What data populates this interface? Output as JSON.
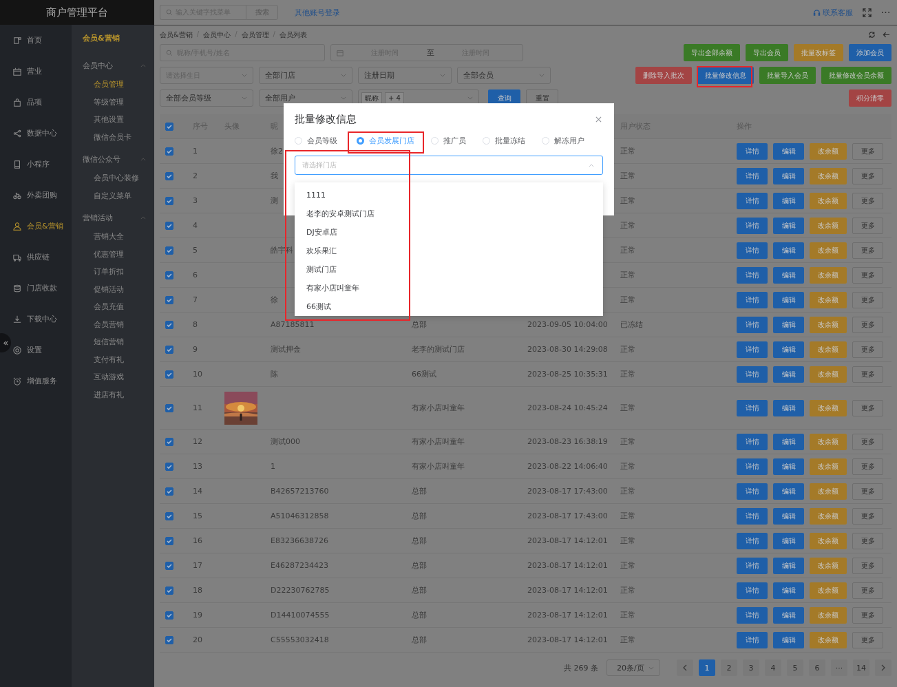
{
  "app": {
    "title": "商户管理平台"
  },
  "sidebar": {
    "items": [
      {
        "label": "首页",
        "selected": false
      },
      {
        "label": "营业",
        "selected": false
      },
      {
        "label": "品项",
        "selected": false
      },
      {
        "label": "数据中心",
        "selected": false
      },
      {
        "label": "小程序",
        "selected": false
      },
      {
        "label": "外卖团购",
        "selected": false
      },
      {
        "label": "会员&营销",
        "selected": true
      },
      {
        "label": "供应链",
        "selected": false
      },
      {
        "label": "门店收款",
        "selected": false
      },
      {
        "label": "下载中心",
        "selected": false
      },
      {
        "label": "设置",
        "selected": false
      },
      {
        "label": "增值服务",
        "selected": false
      }
    ]
  },
  "submenu": {
    "title": "会员&营销",
    "groups": [
      {
        "label": "会员中心",
        "expanded": true,
        "items": [
          {
            "label": "会员管理",
            "selected": true
          },
          {
            "label": "等级管理",
            "selected": false
          },
          {
            "label": "其他设置",
            "selected": false
          },
          {
            "label": "微信会员卡",
            "selected": false
          }
        ]
      },
      {
        "label": "微信公众号",
        "expanded": true,
        "items": [
          {
            "label": "会员中心装修",
            "selected": false
          },
          {
            "label": "自定义菜单",
            "selected": false
          }
        ]
      },
      {
        "label": "营销活动",
        "expanded": true,
        "items": [
          {
            "label": "营销大全",
            "selected": false
          },
          {
            "label": "优惠管理",
            "selected": false
          },
          {
            "label": "订单折扣",
            "selected": false
          },
          {
            "label": "促销活动",
            "selected": false
          },
          {
            "label": "会员充值",
            "selected": false
          },
          {
            "label": "会员营销",
            "selected": false
          },
          {
            "label": "短信营销",
            "selected": false
          },
          {
            "label": "支付有礼",
            "selected": false
          },
          {
            "label": "互动游戏",
            "selected": false
          },
          {
            "label": "进店有礼",
            "selected": false
          }
        ]
      }
    ]
  },
  "topbar": {
    "search_placeholder": "输入关键字找菜单",
    "search_button": "搜索",
    "other_login": "其他账号登录",
    "support": "联系客服"
  },
  "breadcrumb": {
    "items": [
      "会员&营销",
      "会员中心",
      "会员管理",
      "会员列表"
    ],
    "separator": "/"
  },
  "filters": {
    "search": {
      "placeholder": "昵称/手机号/姓名"
    },
    "date_range": {
      "start_placeholder": "注册时间",
      "separator": "至",
      "end_placeholder": "注册时间"
    },
    "row2": [
      {
        "placeholder": "请选择生日"
      },
      {
        "value": "全部门店"
      },
      {
        "value": "注册日期"
      },
      {
        "value": "全部会员"
      }
    ],
    "row3": [
      {
        "value": "全部会员等级"
      },
      {
        "value": "全部用户"
      }
    ],
    "tag_select": {
      "tags": [
        "昵称",
        "+ 4"
      ]
    },
    "query_button": "查询",
    "reset_button": "重置"
  },
  "actions": [
    [
      {
        "label": "导出全部余额",
        "kind": "success"
      },
      {
        "label": "导出会员",
        "kind": "success"
      },
      {
        "label": "批量改标签",
        "kind": "warning"
      },
      {
        "label": "添加会员",
        "kind": "primary"
      }
    ],
    [
      {
        "label": "删除导入批次",
        "kind": "danger"
      },
      {
        "label": "批量修改信息",
        "kind": "primary"
      },
      {
        "label": "批量导入会员",
        "kind": "success"
      },
      {
        "label": "批量修改会员余额",
        "kind": "success"
      }
    ],
    [
      {
        "label": "积分清零",
        "kind": "danger"
      }
    ]
  ],
  "table": {
    "header": {
      "checked": true,
      "no": "序号",
      "avatar": "头像",
      "nickname": "昵",
      "status": "用户状态",
      "actions": "操作"
    },
    "rows": [
      {
        "checked": true,
        "no": "1",
        "nickname": "徐2",
        "status": "正常",
        "actions": [
          "详情",
          "编辑",
          "改余额",
          "更多"
        ]
      },
      {
        "checked": true,
        "no": "2",
        "nickname": "我",
        "status": "正常",
        "actions": [
          "详情",
          "编辑",
          "改余额",
          "更多"
        ]
      },
      {
        "checked": true,
        "no": "3",
        "nickname": "测",
        "status": "正常",
        "actions": [
          "详情",
          "编辑",
          "改余额",
          "更多"
        ]
      },
      {
        "checked": true,
        "no": "4",
        "status": "正常",
        "actions": [
          "详情",
          "编辑",
          "改余额",
          "更多"
        ]
      },
      {
        "checked": true,
        "no": "5",
        "nickname": "皓宇科",
        "status": "正常",
        "actions": [
          "详情",
          "编辑",
          "改余额",
          "更多"
        ]
      },
      {
        "checked": true,
        "no": "6",
        "status": "正常",
        "actions": [
          "详情",
          "编辑",
          "改余额",
          "更多"
        ]
      },
      {
        "checked": true,
        "no": "7",
        "nickname": "徐",
        "status": "正常",
        "actions": [
          "详情",
          "编辑",
          "改余额",
          "更多"
        ]
      },
      {
        "checked": true,
        "no": "8",
        "nickname": "A87185811",
        "store": "总部",
        "date": "2023-09-05 10:04:00",
        "status": "已冻结",
        "actions": [
          "详情",
          "编辑",
          "改余额",
          "更多"
        ]
      },
      {
        "checked": true,
        "no": "9",
        "nickname": "测试押金",
        "store": "老李的测试门店",
        "date": "2023-08-30 14:29:08",
        "status": "正常",
        "actions": [
          "详情",
          "编辑",
          "改余额",
          "更多"
        ]
      },
      {
        "checked": true,
        "no": "10",
        "nickname": "陈",
        "store": "66测试",
        "date": "2023-08-25 10:35:31",
        "status": "正常",
        "actions": [
          "详情",
          "编辑",
          "改余额",
          "更多"
        ]
      },
      {
        "checked": true,
        "no": "11",
        "avatar": {
          "kind": "picture"
        },
        "store": "有家小店叫童年",
        "date": "2023-08-24 10:45:24",
        "status": "正常",
        "actions": [
          "详情",
          "编辑",
          "改余额",
          "更多"
        ]
      },
      {
        "checked": true,
        "no": "12",
        "nickname": "测试000",
        "store": "有家小店叫童年",
        "date": "2023-08-23 16:38:19",
        "status": "正常",
        "actions": [
          "详情",
          "编辑",
          "改余额",
          "更多"
        ]
      },
      {
        "checked": true,
        "no": "13",
        "nickname": "1",
        "store": "有家小店叫童年",
        "date": "2023-08-22 14:06:40",
        "status": "正常",
        "actions": [
          "详情",
          "编辑",
          "改余额",
          "更多"
        ]
      },
      {
        "checked": true,
        "no": "14",
        "nickname": "B42657213760",
        "store": "总部",
        "date": "2023-08-17 17:43:00",
        "status": "正常",
        "actions": [
          "详情",
          "编辑",
          "改余额",
          "更多"
        ]
      },
      {
        "checked": true,
        "no": "15",
        "nickname": "A51046312858",
        "store": "总部",
        "date": "2023-08-17 17:43:00",
        "status": "正常",
        "actions": [
          "详情",
          "编辑",
          "改余额",
          "更多"
        ]
      },
      {
        "checked": true,
        "no": "16",
        "nickname": "E83236638726",
        "store": "总部",
        "date": "2023-08-17 14:12:01",
        "status": "正常",
        "actions": [
          "详情",
          "编辑",
          "改余额",
          "更多"
        ]
      },
      {
        "checked": true,
        "no": "17",
        "nickname": "E46287234423",
        "store": "总部",
        "date": "2023-08-17 14:12:01",
        "status": "正常",
        "actions": [
          "详情",
          "编辑",
          "改余额",
          "更多"
        ]
      },
      {
        "checked": true,
        "no": "18",
        "nickname": "D22230762785",
        "store": "总部",
        "date": "2023-08-17 14:12:01",
        "status": "正常",
        "actions": [
          "详情",
          "编辑",
          "改余额",
          "更多"
        ]
      },
      {
        "checked": true,
        "no": "19",
        "nickname": "D14410074555",
        "store": "总部",
        "date": "2023-08-17 14:12:01",
        "status": "正常",
        "actions": [
          "详情",
          "编辑",
          "改余额",
          "更多"
        ]
      },
      {
        "checked": true,
        "no": "20",
        "nickname": "C55553032418",
        "store": "总部",
        "date": "2023-08-17 14:12:01",
        "status": "正常",
        "actions": [
          "详情",
          "编辑",
          "改余额",
          "更多"
        ]
      }
    ]
  },
  "pagination": {
    "total": "共 269 条",
    "page_size": "20条/页",
    "pages": [
      {
        "label": "1",
        "selected": true
      },
      {
        "label": "2",
        "selected": false
      },
      {
        "label": "3",
        "selected": false
      },
      {
        "label": "4",
        "selected": false
      },
      {
        "label": "5",
        "selected": false
      },
      {
        "label": "6",
        "selected": false
      },
      {
        "label": "···",
        "selected": false
      },
      {
        "label": "14",
        "selected": false
      }
    ]
  },
  "modal": {
    "title": "批量修改信息",
    "options": [
      {
        "label": "会员等级",
        "selected": false
      },
      {
        "label": "会员发展门店",
        "selected": true
      },
      {
        "label": "推广员",
        "selected": false
      },
      {
        "label": "批量冻结",
        "selected": false
      },
      {
        "label": "解冻用户",
        "selected": false
      }
    ],
    "select": {
      "placeholder": "请选择门店",
      "expanded": true
    },
    "dropdown": [
      "1111",
      "老李的安卓测试门店",
      "DJ安卓店",
      "欢乐果汇",
      "测试门店",
      "有家小店叫童年",
      "66测试"
    ]
  }
}
